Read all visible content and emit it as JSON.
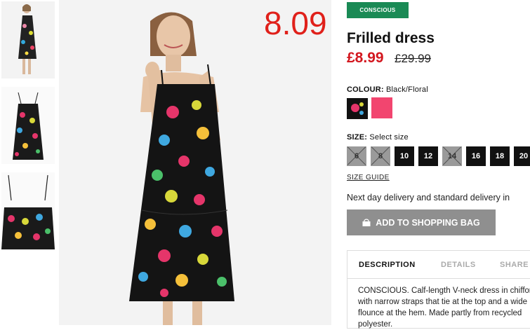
{
  "overlay": {
    "price_text": "8.09"
  },
  "product": {
    "badge": "CONSCIOUS",
    "title": "Frilled dress",
    "price_now": "£8.99",
    "price_was": "£29.99",
    "colour_label": "COLOUR:",
    "colour_value": "Black/Floral",
    "size_label": "SIZE:",
    "size_value": "Select size",
    "sizes": [
      "6",
      "8",
      "10",
      "12",
      "14",
      "16",
      "18",
      "20"
    ],
    "size_guide": "SIZE GUIDE",
    "delivery": "Next day delivery and standard delivery in",
    "add_button": "ADD TO SHOPPING BAG",
    "tabs": [
      "DESCRIPTION",
      "DETAILS",
      "SHARE"
    ],
    "description": "CONSCIOUS. Calf-length V-neck dress in chiffon with narrow straps that tie at the top and a wide flounce at the hem. Made partly from recycled polyester.",
    "swatch_colors": [
      "#111111",
      "#f2456f"
    ]
  },
  "colors": {
    "sale_red": "#d3171f",
    "conscious_green": "#1a8a55",
    "button_grey": "#8f8f8f"
  }
}
